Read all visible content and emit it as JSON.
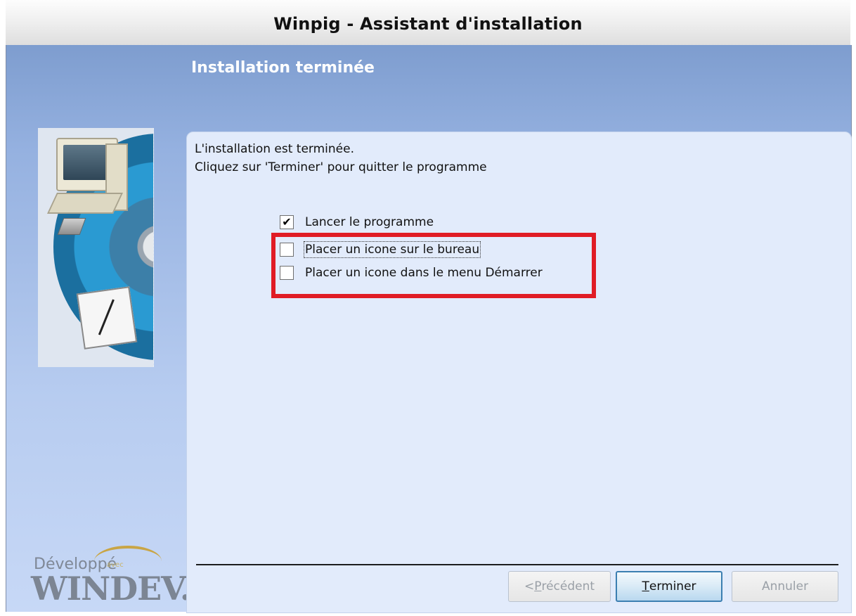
{
  "window": {
    "title": "Winpig - Assistant d'installation"
  },
  "banner": {
    "title": "Installation terminée"
  },
  "message": {
    "line1": "L'installation est terminée.",
    "line2": "Cliquez sur 'Terminer' pour quitter le programme"
  },
  "options": [
    {
      "label": "Lancer le programme",
      "checked": true
    },
    {
      "label": "Placer un icone sur le bureau",
      "checked": false
    },
    {
      "label": "Placer un icone dans le menu Démarrer",
      "checked": false
    }
  ],
  "buttons": {
    "previous_prefix": "< ",
    "previous_mnemonic": "P",
    "previous_rest": "récédent",
    "finish_mnemonic": "T",
    "finish_rest": "erminer",
    "cancel": "Annuler"
  },
  "logo": {
    "top": "Développé",
    "avec": "avec",
    "main": "WINDEV."
  },
  "colors": {
    "highlight": "#e01c25",
    "banner": "#7e9dcf",
    "panel": "#e2ebfb"
  }
}
